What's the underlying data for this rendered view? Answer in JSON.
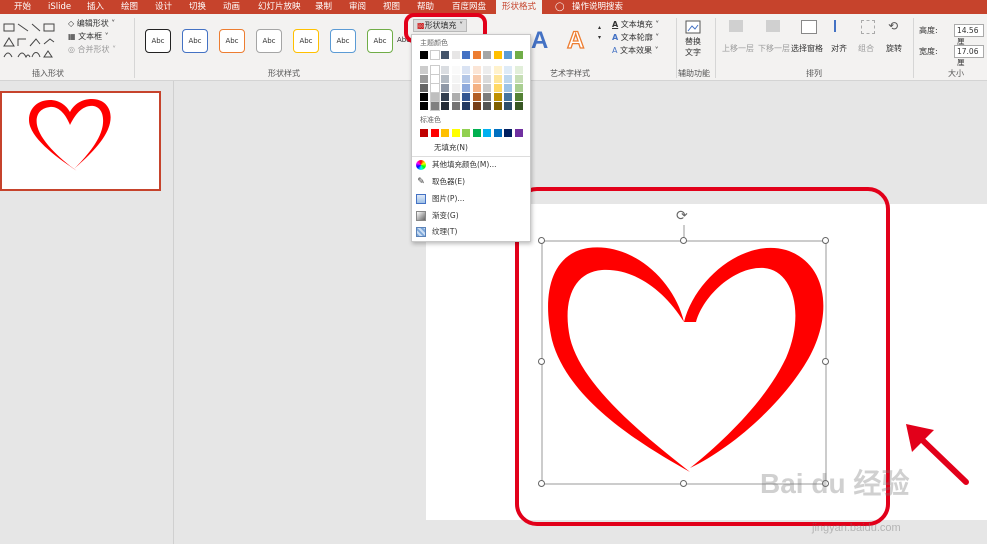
{
  "tabs": [
    "开始",
    "iSlide",
    "插入",
    "绘图",
    "设计",
    "切换",
    "动画",
    "幻灯片放映",
    "录制",
    "审阅",
    "视图",
    "帮助",
    "百度网盘",
    "形状格式",
    "操作说明搜索"
  ],
  "active_tab": "形状格式",
  "ribbon": {
    "insert_shapes": {
      "edit_shape": "编辑形状",
      "text_box": "文本框",
      "merge_shapes": "合并形状",
      "label": "插入形状"
    },
    "shape_styles": {
      "style_text": "Abc",
      "label": "形状样式"
    },
    "shape_fill_button": "形状填充",
    "wordart": {
      "sample": "A",
      "text_fill": "文本填充",
      "text_outline": "文本轮廓",
      "text_effects": "文本效果",
      "label": "艺术字样式"
    },
    "accessibility": {
      "alt_text_line1": "替换",
      "alt_text_line2": "文字",
      "label": "辅助功能"
    },
    "arrange": {
      "bring_forward": "上移一层",
      "send_backward": "下移一层",
      "selection_pane": "选择窗格",
      "align": "对齐",
      "group": "组合",
      "rotate": "旋转",
      "label": "排列"
    },
    "size": {
      "height_label": "高度:",
      "height_value": "14.56 厘",
      "width_label": "宽度:",
      "width_value": "17.06 厘",
      "label": "大小"
    }
  },
  "dropdown": {
    "theme_colors_label": "主题颜色",
    "standard_colors_label": "标准色",
    "no_fill": "无填充(N)",
    "more_colors": "其他填充颜色(M)...",
    "eyedropper": "取色器(E)",
    "picture": "图片(P)...",
    "gradient": "渐变(G)",
    "texture": "纹理(T)",
    "theme_colors": [
      "#000000",
      "#ffffff",
      "#44546a",
      "#e7e6e6",
      "#4472c4",
      "#ed7d31",
      "#a5a5a5",
      "#ffc000",
      "#5b9bd5",
      "#70ad47"
    ],
    "standard_colors": [
      "#c00000",
      "#ff0000",
      "#ffc000",
      "#ffff00",
      "#92d050",
      "#00b050",
      "#00b0f0",
      "#0070c0",
      "#002060",
      "#7030a0"
    ]
  },
  "colors": {
    "accent": "#c6432c",
    "highlight": "#e2001a",
    "heart": "#ff0000"
  },
  "watermark": {
    "brand": "Bai du 经验",
    "url": "jingyan.baidu.com"
  }
}
